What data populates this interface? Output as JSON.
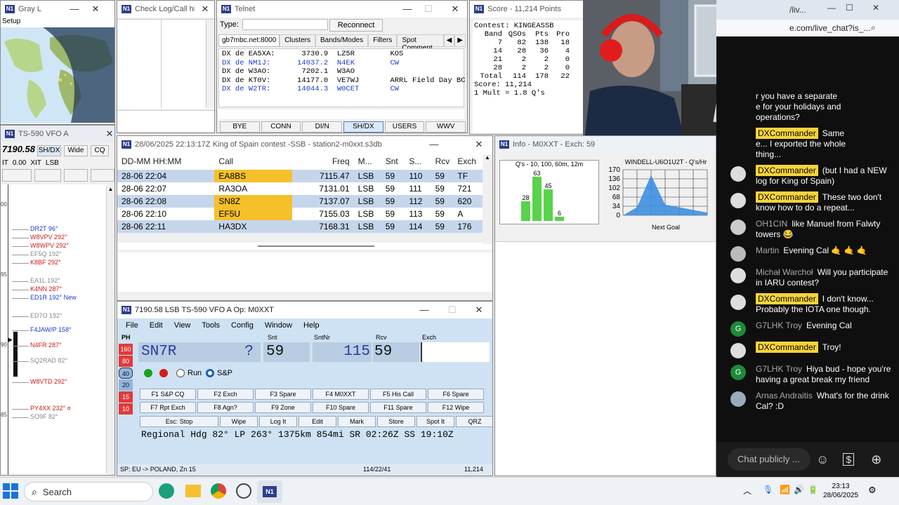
{
  "grayline": {
    "title": "Gray L",
    "menu": "Setup"
  },
  "checklog": {
    "title": "Check Log/Call his..."
  },
  "telnet": {
    "title": "Telnet",
    "type_label": "Type:",
    "reconnect": "Reconnect",
    "tabs": [
      "gb7mbc.net:8000",
      "Clusters",
      "Bands/Modes",
      "Filters",
      "Spot Comment"
    ],
    "spots": [
      {
        "text": "DX de EA5XA:      3730.9  LZ5R        KOS",
        "color": "#000"
      },
      {
        "text": "DX de NM1J:      14037.2  N4EK        CW",
        "color": "#1a3bcc"
      },
      {
        "text": "DX de W3AO:       7202.1  W3AO",
        "color": "#000"
      },
      {
        "text": "DX de KT0V:      14177.0  VE7WJ       ARRL Field Day BC",
        "color": "#000"
      },
      {
        "text": "DX de W2TR:      14044.3  W0CET       CW",
        "color": "#1a3bcc"
      }
    ],
    "buttons": [
      "BYE",
      "CONN",
      "DI/N",
      "SH/DX",
      "USERS",
      "WWV"
    ]
  },
  "score": {
    "title": "Score - 11,214 Points",
    "contest": "Contest: KINGEASSB",
    "header": {
      "band": "Band",
      "qsos": "QSOs",
      "pts": "Pts",
      "pro": "Pro"
    },
    "rows": [
      {
        "band": "7",
        "qsos": "82",
        "pts": "138",
        "pro": "18"
      },
      {
        "band": "14",
        "qsos": "28",
        "pts": "36",
        "pro": "4"
      },
      {
        "band": "21",
        "qsos": "2",
        "pts": "2",
        "pro": "0"
      },
      {
        "band": "28",
        "qsos": "2",
        "pts": "2",
        "pro": "0"
      }
    ],
    "total": {
      "band": "Total",
      "qsos": "114",
      "pts": "178",
      "pro": "22"
    },
    "score_line": "Score: 11,214",
    "mult_line": "1 Mult = 1.8 Q's"
  },
  "chat": {
    "tab_title": "/liv...",
    "url": "e.com/live_chat?is_...",
    "messages": [
      {
        "user": "",
        "mod": false,
        "text": "r you have a separate\ne for your holidays and\noperations?",
        "av": ""
      },
      {
        "user": "DXCommander",
        "mod": true,
        "text": "Same\ne... I exported the whole\nthing...",
        "av": ""
      },
      {
        "user": "DXCommander",
        "mod": true,
        "text": "(but I had a NEW log for King of Spain)",
        "av": "D"
      },
      {
        "user": "DXCommander",
        "mod": true,
        "text": "These two don't know how to do a repeat...",
        "av": "D"
      },
      {
        "user": "OH1CIN",
        "mod": false,
        "text": "like Manuel from Falwty towers 😂",
        "av": "O"
      },
      {
        "user": "Martin",
        "mod": false,
        "text": "Evening Cal 🤙 🤙 🤙",
        "av": "M"
      },
      {
        "user": "Michał Warchoł",
        "mod": false,
        "text": "Will you participate in IARU contest?",
        "av": "W"
      },
      {
        "user": "DXCommander",
        "mod": true,
        "text": "I don't know... Probably the IOTA one though.",
        "av": "D"
      },
      {
        "user": "G7LHK Troy",
        "mod": false,
        "text": "Evening Cal",
        "av": "G"
      },
      {
        "user": "DXCommander",
        "mod": true,
        "text": "Troy!",
        "av": "D"
      },
      {
        "user": "G7LHK Troy",
        "mod": false,
        "text": "Hiya bud - hope you're having a great break my friend",
        "av": "G"
      },
      {
        "user": "Arnas Andraitis",
        "mod": false,
        "text": "What's for the drink Cal? :D",
        "av": "A"
      }
    ],
    "input_placeholder": "Chat publicly ..."
  },
  "vfo": {
    "title": "TS-590 VFO A",
    "freq": "7190.58",
    "btns": [
      "SH/DX",
      "Wide",
      "CQ"
    ],
    "rit": "IT",
    "rit_val": "0.00",
    "xit": "XIT",
    "mode": "LSB",
    "scale": [
      "00",
      "95",
      "90",
      "85",
      "SB"
    ],
    "spots": [
      {
        "call": "DR2T 96°",
        "color": "#1a3bcc"
      },
      {
        "call": "W8VPV 292°",
        "color": "#cc1a1a"
      },
      {
        "call": "W8WPV 292°",
        "color": "#cc1a1a"
      },
      {
        "call": "EF5Q 192°",
        "color": "#888"
      },
      {
        "call": "K8BF 292°",
        "color": "#cc1a1a"
      },
      {
        "call": "EA1L 192°",
        "color": "#888"
      },
      {
        "call": "K4NN 287°",
        "color": "#cc1a1a"
      },
      {
        "call": "ED1R 192° New",
        "color": "#1a3bcc"
      },
      {
        "call": "ED7O 192°",
        "color": "#888"
      },
      {
        "call": "F4JAW/P 158°",
        "color": "#1a3bcc"
      },
      {
        "call": "N4FR 287°",
        "color": "#cc1a1a"
      },
      {
        "call": "SQ2RAD 82°",
        "color": "#888"
      },
      {
        "call": "W8VTD 292°",
        "color": "#cc1a1a"
      },
      {
        "call": "PY4XX 232° ¤",
        "color": "#cc1a1a"
      },
      {
        "call": "SO9F 82°",
        "color": "#888"
      }
    ]
  },
  "log": {
    "title": "28/06/2025 22:13:17Z  King of Spain contest -SSB - station2-m0xxt.s3db",
    "headers": [
      "DD-MM HH:MM",
      "Call",
      "Freq",
      "M...",
      "Snt",
      "S...",
      "Rcv",
      "Exch"
    ],
    "rows": [
      {
        "dt": "28-06 22:04",
        "call": "EA8BS",
        "freq": "7115.47",
        "mode": "LSB",
        "snt": "59",
        "sn": "110",
        "rcv": "59",
        "exch": "TF",
        "hl": true
      },
      {
        "dt": "28-06 22:07",
        "call": "RA3OA",
        "freq": "7131.01",
        "mode": "LSB",
        "snt": "59",
        "sn": "111",
        "rcv": "59",
        "exch": "721",
        "hl": false
      },
      {
        "dt": "28-06 22:08",
        "call": "SN8Z",
        "freq": "7137.07",
        "mode": "LSB",
        "snt": "59",
        "sn": "112",
        "rcv": "59",
        "exch": "620",
        "hl": true
      },
      {
        "dt": "28-06 22:10",
        "call": "EF5U",
        "freq": "7155.03",
        "mode": "LSB",
        "snt": "59",
        "sn": "113",
        "rcv": "59",
        "exch": "A",
        "hl": true
      },
      {
        "dt": "28-06 22:11",
        "call": "HA3DX",
        "freq": "7168.31",
        "mode": "LSB",
        "snt": "59",
        "sn": "114",
        "rcv": "59",
        "exch": "176",
        "hl": false
      }
    ]
  },
  "info": {
    "title": "Info - M0XXT - Exch: 59",
    "chart1_title": "Q's - 10, 100, 60m, 12m",
    "chart2_title": "WINDELL-U6O1U2T - Q's/Hr",
    "next_goal": "Next Goal"
  },
  "qs_chart": {
    "values": [
      28,
      63,
      45,
      6
    ],
    "labels": [
      "28",
      "63",
      "45",
      "6"
    ]
  },
  "rate_chart": {
    "yticks": [
      "170",
      "136",
      "102",
      "68",
      "34",
      "0"
    ],
    "points": [
      0,
      30,
      150,
      40,
      30,
      20,
      10
    ]
  },
  "entry": {
    "title": "7190.58 LSB TS-590 VFO A    Op: M0XXT",
    "menu": [
      "File",
      "Edit",
      "View",
      "Tools",
      "Config",
      "Window",
      "Help"
    ],
    "labels": {
      "snt": "Snt",
      "sntnr": "SntNr",
      "rcv": "Rcv",
      "exch": "Exch"
    },
    "mode_label": "PH",
    "call": "SN7R",
    "call_flag": "?",
    "snt": "59",
    "sntnr": "115",
    "rcv": "59",
    "bands": [
      "160",
      "80",
      "40",
      "20",
      "15",
      "10"
    ],
    "run_label": "Run",
    "sp_label": "S&P",
    "fkeys1": [
      "F1 S&P CQ",
      "F2 Exch",
      "F3 Spare",
      "F4 M0XXT",
      "F5 His Call",
      "F6 Spare"
    ],
    "fkeys2": [
      "F7 Rpt Exch",
      "F8 Agn?",
      "F9 Zone",
      "F10 Spare",
      "F11 Spare",
      "F12 Wipe"
    ],
    "fkeys3": [
      "Esc: Stop",
      "Wipe",
      "Log It",
      "Edit",
      "Mark",
      "Store",
      "Spot It",
      "QRZ"
    ],
    "info_line": "Regional Hdg 82° LP 263° 1375km 854mi SR 02:26Z SS 19:10Z",
    "status_left": "SP: EU -> POLAND, Zn 15",
    "status_mid": "114/22/41",
    "status_right": "11,214"
  },
  "taskbar": {
    "search": "Search",
    "time": "23:13",
    "date": "28/06/2025"
  }
}
